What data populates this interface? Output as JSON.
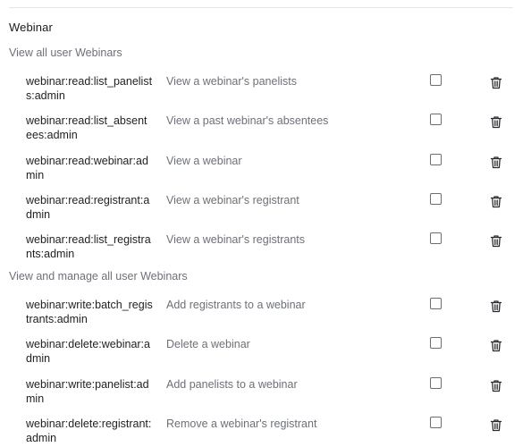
{
  "section": {
    "title": "Webinar"
  },
  "groups": [
    {
      "label": "View all user Webinars",
      "rows": [
        {
          "scope": "webinar:read:list_panelists:admin",
          "description": "View a webinar's panelists"
        },
        {
          "scope": "webinar:read:list_absentees:admin",
          "description": "View a past webinar's absentees"
        },
        {
          "scope": "webinar:read:webinar:admin",
          "description": "View a webinar"
        },
        {
          "scope": "webinar:read:registrant:admin",
          "description": "View a webinar's registrant"
        },
        {
          "scope": "webinar:read:list_registrants:admin",
          "description": "View a webinar's registrants"
        }
      ]
    },
    {
      "label": "View and manage all user Webinars",
      "rows": [
        {
          "scope": "webinar:write:batch_registrants:admin",
          "description": "Add registrants to a webinar"
        },
        {
          "scope": "webinar:delete:webinar:admin",
          "description": "Delete a webinar"
        },
        {
          "scope": "webinar:write:panelist:admin",
          "description": "Add panelists to a webinar"
        },
        {
          "scope": "webinar:delete:registrant:admin",
          "description": "Remove a webinar's registrant"
        }
      ]
    }
  ],
  "icons": {
    "row_checkbox": "checkbox-icon",
    "row_delete": "trash-icon"
  }
}
